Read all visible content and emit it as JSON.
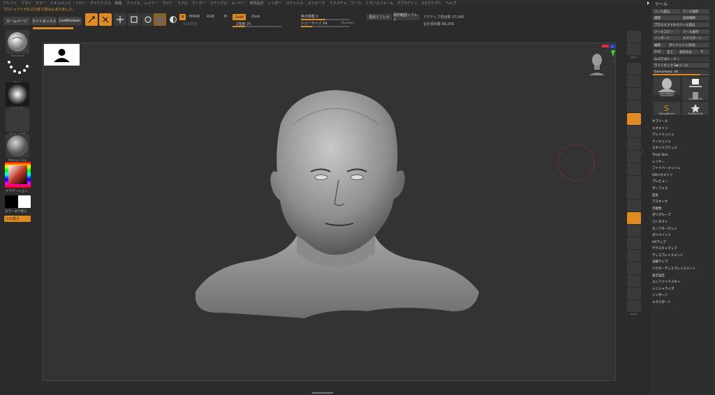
{
  "menubar": [
    "アルファ",
    "ブラシ",
    "カラー",
    "ドキュメント",
    "ドロー",
    "ダイナミクス",
    "編集",
    "ファイル",
    "レイヤー",
    "ライト",
    "マクロ",
    "マーカー",
    "マテリアル",
    "ムービー",
    "環境設定",
    "レンダー",
    "ステンシル",
    "ストローク",
    "テクスチャ",
    "ツール",
    "トランスフォーム",
    "Zプラグイン",
    "Zスクリプト",
    "ヘルプ"
  ],
  "notice": "プロジェクトが0.211秒で読み込まれました。",
  "quick": {
    "home": "ホームページ",
    "lightbox": "ライトボックス",
    "live": "LiveBoolean"
  },
  "toolbar": {
    "m": "M",
    "mrgb": "MRGB",
    "rgb": "RGB",
    "m2": "M",
    "zadd": "Zadd",
    "zsub": "Zsub",
    "rgb_intensity": "RGB強度",
    "z_intensity": "Z強度 25",
    "focal": "焦点移動 0",
    "draw_size": "ドローサイズ 64",
    "dynamic": "Dynamic",
    "vertex_btn": "頂点ソフレイ",
    "poly_btn": "選択範囲ソフレイ",
    "active_points": "アクティブ頂点数 37,095",
    "total_points": "合計頂点数 68,259"
  },
  "left": {
    "brush": "Standard",
    "stroke": "Dots",
    "alpha": "Alpha 01",
    "texture": "Texture Off",
    "material": "MatCap Gray",
    "gradient": "グラデーション",
    "switch": "カラー切り替え",
    "swap": "入れ替え"
  },
  "right_strip": [
    "BPR",
    "SPix 3",
    "スクロール",
    "ズーム",
    "100%",
    "50%",
    "AAHalf",
    "ダイナミック",
    "パースペクティブ",
    "フロア",
    "ローカル",
    "Gxyz",
    "フレーム",
    "移動",
    "スケール",
    "回転",
    "Line Fill",
    "ポリF",
    "透明",
    "ゴースト",
    "ソロ",
    "Xpose"
  ],
  "tool": {
    "title": "ツール",
    "row1": [
      "ツール読込",
      "ツール保存"
    ],
    "row2": [
      "複製",
      "追加複製"
    ],
    "row3": "プロジェクトからツール読込",
    "row4": [
      "ツールコピー",
      "ツール貼付"
    ],
    "row5": [
      "インポート",
      "エクスポート"
    ],
    "row6": [
      "複製",
      "ポリメッシュ3D化"
    ],
    "row7": [
      "GoZ",
      "全て",
      "表示のみ",
      "R"
    ],
    "row8": "GoZ方式ルーチン",
    "row9": "ライトボックス▶ツール",
    "slider": "DemoHead: 48",
    "thumbs": [
      "DemoHead",
      "SimpleBrush",
      "DemoHead",
      "Cylinder3D",
      "SimpleBrush",
      "PolyMesh3D"
    ],
    "subpalettes": [
      "サブツール",
      "ジオメトリ",
      "アレイメッシュ",
      "ナノメッシュ",
      "スタイルブリッジ",
      "Thick Skin",
      "レイヤー",
      "ファイバーメッシュ",
      "HDジオメトリ",
      "プレビュー",
      "サーフェス",
      "変形",
      "マスキング",
      "可視性",
      "ポリグループ",
      "コンタクト",
      "モーフターゲット",
      "ポリペイント",
      "UVマップ",
      "テクスチャマップ",
      "ディスプレイスメント",
      "法線マップ",
      "ベクターディスプレイスメント",
      "表示設定",
      "ユニファイドスキン",
      "イニシャライズ",
      "インポート",
      "エクスポート"
    ]
  },
  "colors": {
    "accent": "#e08a22",
    "bg": "#2b2b2b",
    "canvas": "#333333"
  }
}
